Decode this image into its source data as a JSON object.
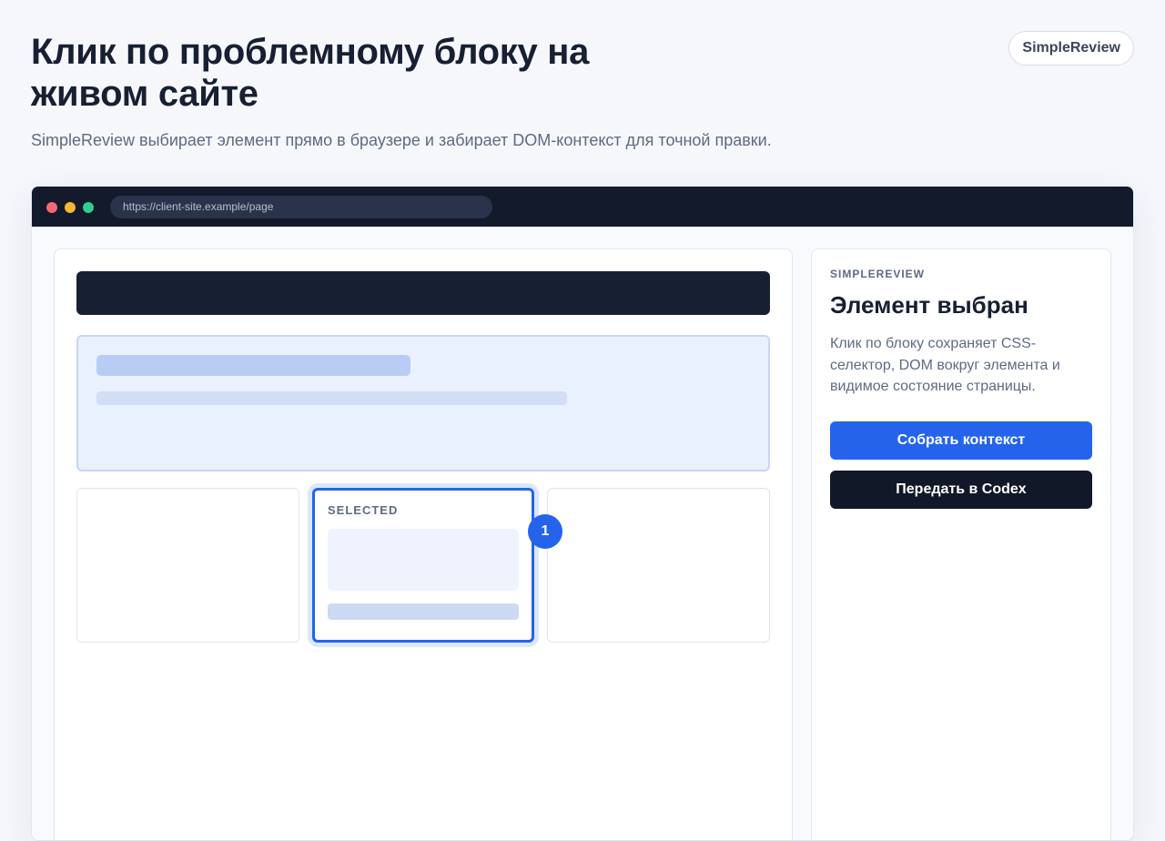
{
  "page": {
    "title": "Клик по проблемному блоку на живом сайте",
    "subtitle": "SimpleReview выбирает элемент прямо в браузере и забирает DOM-контекст для точной правки.",
    "brand": "SimpleReview"
  },
  "browser": {
    "url": "https://client-site.example/page"
  },
  "site": {
    "selected_card_label": "SELECTED",
    "selection_badge": "1"
  },
  "panel": {
    "kicker": "SIMPLEREVIEW",
    "title": "Элемент выбран",
    "description": "Клик по блоку сохраняет CSS-селектор, DOM вокруг элемента и видимое состояние страницы.",
    "primary_button": "Собрать контекст",
    "secondary_button": "Передать в Codex"
  },
  "colors": {
    "accent": "#2563eb",
    "dark": "#111827",
    "background": "#f5f7fb"
  }
}
